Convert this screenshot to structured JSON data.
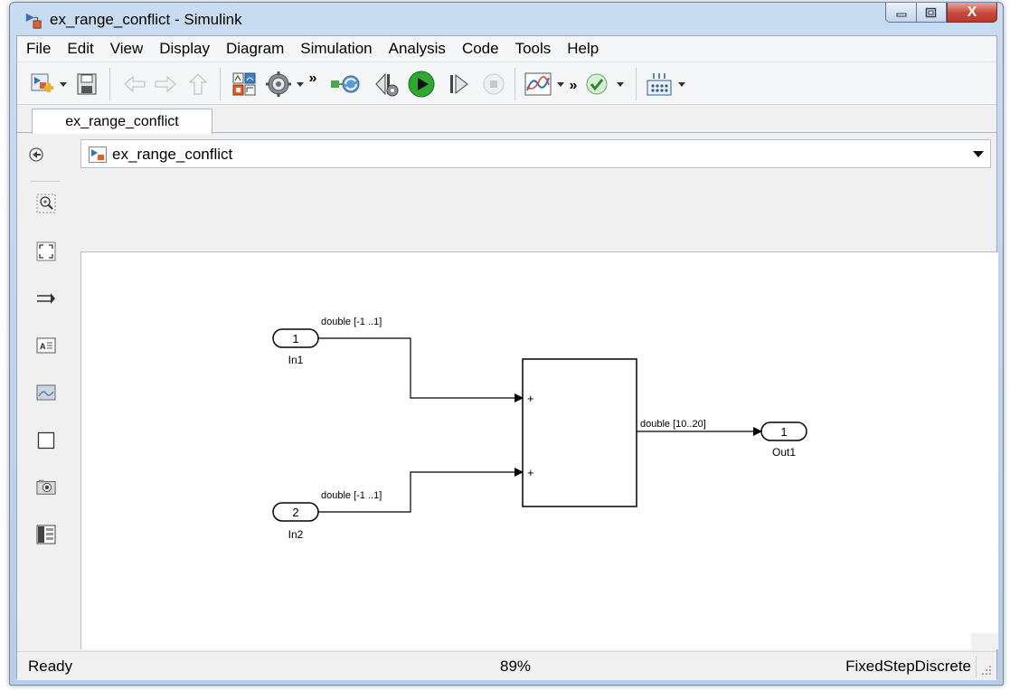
{
  "window": {
    "title": "ex_range_conflict - Simulink",
    "minimize_glyph": "–",
    "maximize_glyph": "□",
    "close_glyph": "X"
  },
  "menu": [
    "File",
    "Edit",
    "View",
    "Display",
    "Diagram",
    "Simulation",
    "Analysis",
    "Code",
    "Tools",
    "Help"
  ],
  "toolbar": {
    "overflow_glyph": "»",
    "icons": [
      "new-model-icon",
      "save-icon",
      "back-arrow-icon",
      "forward-arrow-icon",
      "up-arrow-icon",
      "library-browser-icon",
      "model-settings-icon",
      "update-diagram-icon",
      "step-back-icon",
      "run-icon",
      "step-forward-icon",
      "stop-icon",
      "scope-icon",
      "check-icon",
      "breakpoints-icon"
    ]
  },
  "tab": {
    "label": "ex_range_conflict"
  },
  "address": {
    "path": "ex_range_conflict"
  },
  "palette": [
    "zoom-icon",
    "fit-to-view-icon",
    "signal-route-icon",
    "annotation-icon",
    "image-icon",
    "area-icon",
    "screenshot-icon",
    "model-browser-icon"
  ],
  "diagram": {
    "inports": [
      {
        "number": "1",
        "name": "In1",
        "signal_label": "double [-1 ..1]"
      },
      {
        "number": "2",
        "name": "In2",
        "signal_label": "double [-1 ..1]"
      }
    ],
    "sum_block": {
      "signs": [
        "+",
        "+"
      ]
    },
    "output_signal_label": "double [10..20]",
    "outport": {
      "number": "1",
      "name": "Out1"
    }
  },
  "status": {
    "state": "Ready",
    "zoom": "89%",
    "solver": "FixedStepDiscrete"
  },
  "colors": {
    "title_bar": "#c9dcf1",
    "close_button": "#c6493a",
    "run_green": "#2fa82f",
    "model_icon_orange": "#e0602a",
    "model_icon_blue": "#3a6fb0"
  }
}
